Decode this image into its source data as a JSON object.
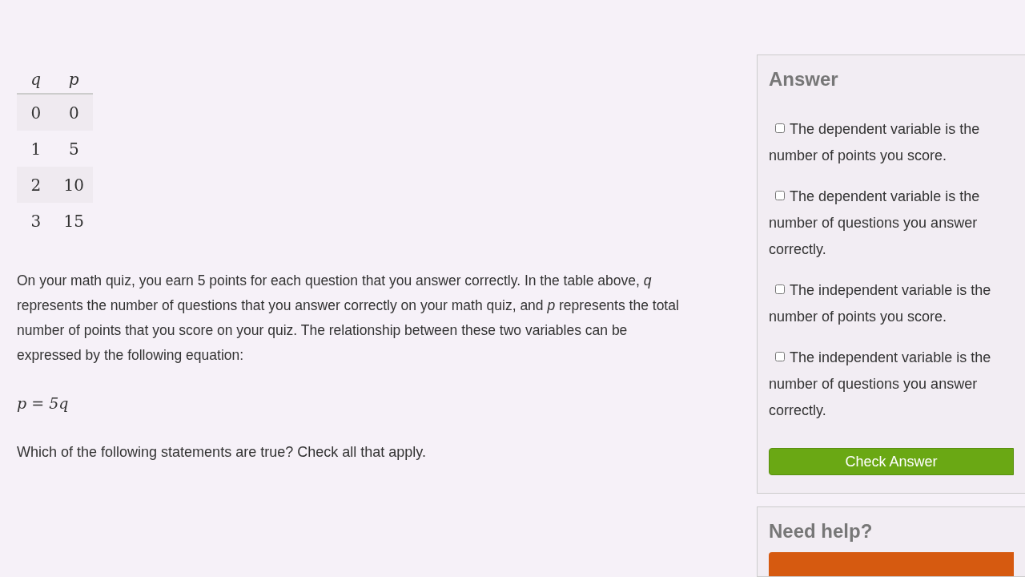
{
  "table": {
    "columns": [
      "q",
      "p"
    ],
    "rows": [
      [
        "0",
        "0"
      ],
      [
        "1",
        "5"
      ],
      [
        "2",
        "10"
      ],
      [
        "3",
        "15"
      ]
    ]
  },
  "problem": "On your math quiz, you earn 5 points for each question that you answer correctly. In the table above, *q* represents the number of questions that you answer correctly on your math quiz, and *p* represents the total number of points that you score on your quiz. The relationship between these two variables can be expressed by the following equation:",
  "equation": "p = 5q",
  "question": "Which of the following statements are true? Check all that apply.",
  "answer": {
    "title": "Answer",
    "options": [
      {
        "label": "The dependent variable is the number of points you score.",
        "checked": false
      },
      {
        "label": "The dependent variable is the number of questions you answer correctly.",
        "checked": false
      },
      {
        "label": "The independent variable is the number of points you score.",
        "checked": false
      },
      {
        "label": "The independent variable is the number of questions you answer correctly.",
        "checked": false
      }
    ],
    "button": "Check Answer"
  },
  "help": {
    "title": "Need help?"
  }
}
